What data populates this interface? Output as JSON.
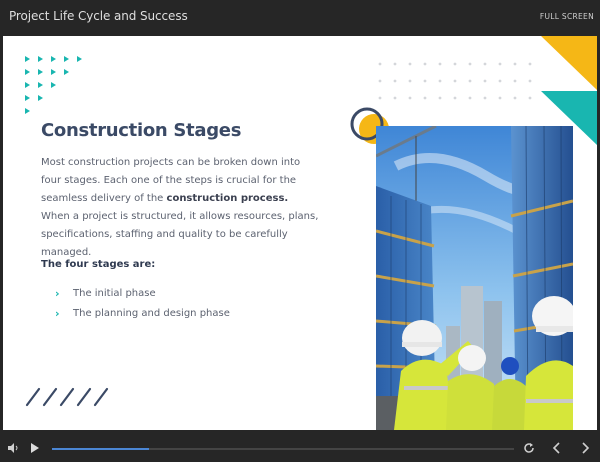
{
  "window": {
    "title": "Project Life Cycle and Success",
    "fullscreen_label": "FULL SCREEN"
  },
  "slide": {
    "heading": "Construction Stages",
    "body_part1": "Most construction projects can be broken down into four stages. Each one of the steps is crucial for the seamless delivery of the ",
    "body_bold": "construction process.",
    "body_part2": " When a project is structured, it allows resources, plans, specifications, staffing and quality to be carefully managed.",
    "subheading": "The four stages are:",
    "stages": [
      "The initial phase",
      "The planning and design phase"
    ]
  },
  "player": {
    "progress_fraction": 0.21
  },
  "colors": {
    "teal": "#19b6b0",
    "yellow": "#f5b716",
    "navy": "#3b4a66",
    "progress": "#4b86d4"
  },
  "icons": {
    "volume": "volume-icon",
    "play": "play-icon",
    "replay": "replay-icon",
    "prev": "chevron-left-icon",
    "next": "chevron-right-icon",
    "bullet": "chevron-right-icon"
  }
}
